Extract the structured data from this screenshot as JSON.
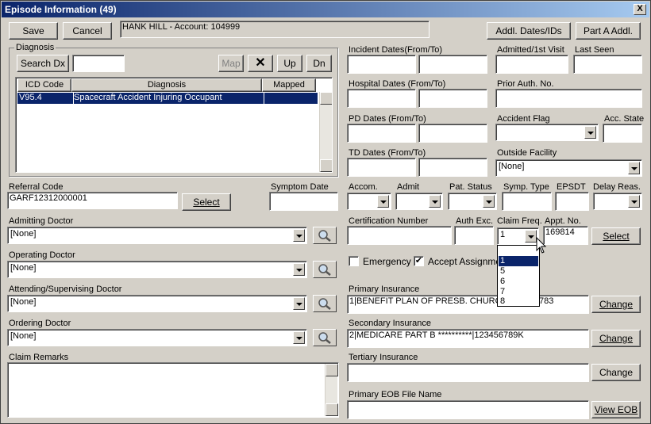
{
  "window": {
    "title": "Episode Information (49)",
    "close": "X"
  },
  "toolbar": {
    "save": "Save",
    "cancel": "Cancel",
    "patient_info": "HANK HILL - Account: 104999",
    "addl_dates": "Addl. Dates/IDs",
    "part_a": "Part A Addl."
  },
  "diagnosis": {
    "group_label": "Diagnosis",
    "search_label": "Search Dx",
    "search_value": "",
    "map": "Map",
    "delete_icon": "close-icon",
    "up": "Up",
    "dn": "Dn",
    "columns": [
      "ICD Code",
      "Diagnosis",
      "Mapped"
    ],
    "rows": [
      {
        "code": "V95.4",
        "desc": "Spacecraft Accident Injuring Occupant",
        "mapped": ""
      }
    ]
  },
  "left": {
    "referral_code_label": "Referral Code",
    "referral_code": "GARF12312000001",
    "select": "Select",
    "symptom_date_label": "Symptom Date",
    "symptom_date": "",
    "admitting_label": "Admitting Doctor",
    "admitting": "[None]",
    "operating_label": "Operating Doctor",
    "operating": "[None]",
    "attending_label": "Attending/Supervising Doctor",
    "attending": "[None]",
    "ordering_label": "Ordering Doctor",
    "ordering": "[None]",
    "remarks_label": "Claim Remarks",
    "remarks": ""
  },
  "right": {
    "incident_label": "Incident Dates(From/To)",
    "admitted_label": "Admitted/1st Visit",
    "last_seen_label": "Last Seen",
    "hospital_label": "Hospital Dates (From/To)",
    "prior_auth_label": "Prior Auth. No.",
    "pd_label": "PD Dates (From/To)",
    "accident_flag_label": "Accident Flag",
    "acc_state_label": "Acc. State",
    "td_label": "TD Dates (From/To)",
    "outside_facility_label": "Outside Facility",
    "outside_facility": "[None]",
    "accom_label": "Accom.",
    "admit_label": "Admit",
    "pat_status_label": "Pat. Status",
    "symp_type_label": "Symp. Type",
    "epsdt_label": "EPSDT",
    "delay_label": "Delay Reas.",
    "cert_label": "Certification Number",
    "auth_exc_label": "Auth Exc.",
    "claim_freq_label": "Claim Freq.",
    "claim_freq": "1",
    "appt_label": "Appt. No.",
    "appt_no": "169814",
    "select": "Select",
    "emergency_label": "Emergency",
    "accept_label": "Accept Assignment",
    "emergency_checked": false,
    "accept_checked": true,
    "primary_label": "Primary Insurance",
    "primary": "1|BENEFIT PLAN OF PRESB. CHURCH|123456783",
    "secondary_label": "Secondary Insurance",
    "secondary": "2|MEDICARE PART B **********|123456789K",
    "tertiary_label": "Tertiary Insurance",
    "tertiary": "",
    "change": "Change",
    "eob_label": "Primary EOB File Name",
    "eob": "",
    "view_eob": "View EOB"
  },
  "claim_freq_options": [
    "1",
    "5",
    "6",
    "7",
    "8"
  ],
  "colors": {
    "title_start": "#0a246a",
    "title_end": "#a6caf0",
    "selection": "#0a246a",
    "face": "#d4d0c8"
  }
}
